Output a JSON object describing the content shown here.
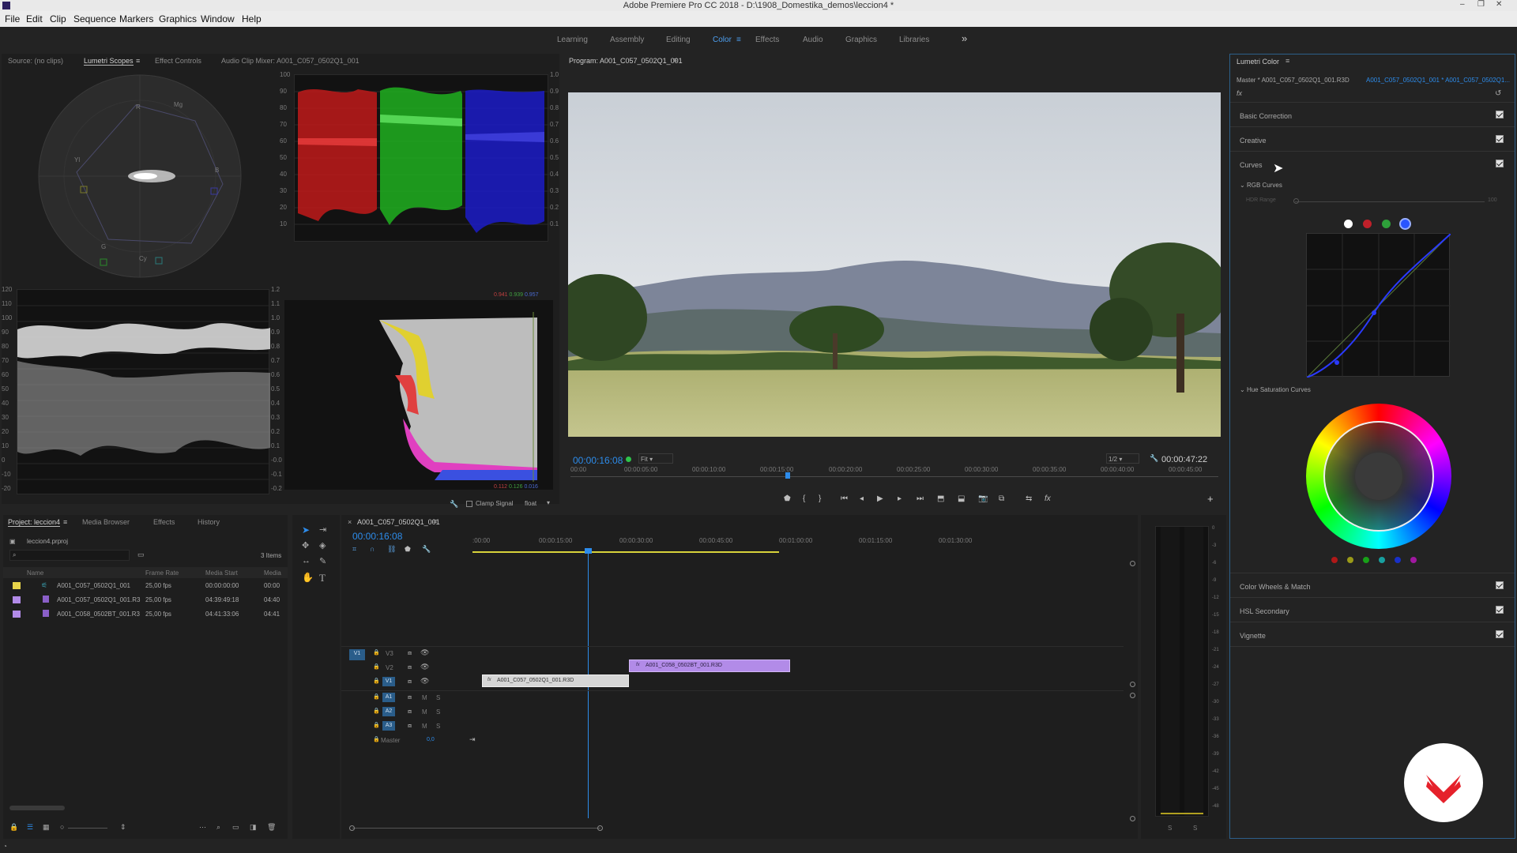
{
  "window": {
    "title": "Adobe Premiere Pro CC 2018 - D:\\1908_Domestika_demos\\leccion4 *"
  },
  "menu": [
    "File",
    "Edit",
    "Clip",
    "Sequence",
    "Markers",
    "Graphics",
    "Window",
    "Help"
  ],
  "workspaces": [
    "Learning",
    "Assembly",
    "Editing",
    "Color",
    "Effects",
    "Audio",
    "Graphics",
    "Libraries"
  ],
  "active_workspace": "Color",
  "source_panel": {
    "tabs": [
      "Source: (no clips)",
      "Lumetri Scopes",
      "Effect Controls",
      "Audio Clip Mixer: A001_C057_0502Q1_001"
    ],
    "parade_scale": [
      "100",
      "90",
      "80",
      "70",
      "60",
      "50",
      "40",
      "30",
      "20",
      "10"
    ],
    "parade_right_scale": [
      "1.0",
      "0.9",
      "0.8",
      "0.7",
      "0.6",
      "0.5",
      "0.4",
      "0.3",
      "0.2",
      "0.1"
    ],
    "waveform_scale": [
      "120",
      "110",
      "100",
      "90",
      "80",
      "70",
      "60",
      "50",
      "40",
      "30",
      "20",
      "10",
      "0",
      "-10",
      "-20"
    ],
    "waveform_right_scale": [
      "1.2",
      "1.1",
      "1.0",
      "0.9",
      "0.8",
      "0.7",
      "0.6",
      "0.5",
      "0.4",
      "0.3",
      "0.2",
      "0.1",
      "-0.0",
      "-0.1",
      "-0.2"
    ],
    "hist_top_values": [
      "0.941",
      "0.939",
      "0.957"
    ],
    "hist_bottom_values": [
      "0.112",
      "0.126",
      "0.016"
    ],
    "clamp_signal": "Clamp Signal",
    "float_label": "float",
    "vectorscope_labels": [
      "R",
      "Mg",
      "B",
      "Cy",
      "G",
      "Yl"
    ]
  },
  "program": {
    "tab": "Program: A001_C057_0502Q1_001",
    "timecode": "00:00:16:08",
    "fit": "Fit",
    "resolution": "1/2",
    "duration": "00:00:47:22",
    "ruler": [
      "00:00",
      "00:00:05:00",
      "00:00:10:00",
      "00:00:15:00",
      "00:00:20:00",
      "00:00:25:00",
      "00:00:30:00",
      "00:00:35:00",
      "00:00:40:00",
      "00:00:45:00"
    ]
  },
  "lumetri": {
    "title": "Lumetri Color",
    "master": "Master * A001_C057_0502Q1_001.R3D",
    "clip": "A001_C057_0502Q1_001 * A001_C057_0502Q1...",
    "fx": "fx",
    "sections": [
      "Basic Correction",
      "Creative",
      "Curves"
    ],
    "rgb_curves": "RGB Curves",
    "hdr_range": "HDR Range",
    "hdr_value": "100",
    "hue_sat": "Hue Saturation Curves",
    "bottom_sections": [
      "Color Wheels & Match",
      "HSL Secondary",
      "Vignette"
    ],
    "channel_colors": [
      "#ffffff",
      "#c0202a",
      "#2ea03a",
      "#2a55ff"
    ],
    "swatches": [
      "#b01818",
      "#9a9a18",
      "#18a018",
      "#18a0a0",
      "#1830c8",
      "#a018a0"
    ]
  },
  "project": {
    "tabs": [
      "Project: leccion4",
      "Media Browser",
      "Effects",
      "History"
    ],
    "file": "leccion4.prproj",
    "items_count": "3 Items",
    "columns": [
      "Name",
      "Frame Rate",
      "Media Start",
      "Media"
    ],
    "rows": [
      {
        "color": "#e7d44a",
        "name": "A001_C057_0502Q1_001",
        "fps": "25,00 fps",
        "start": "00:00:00:00",
        "media": "00:00"
      },
      {
        "color": "#b28be8",
        "name": "A001_C057_0502Q1_001.R3",
        "fps": "25,00 fps",
        "start": "04:39:49:18",
        "media": "04:40"
      },
      {
        "color": "#b28be8",
        "name": "A001_C058_0502BT_001.R3",
        "fps": "25,00 fps",
        "start": "04:41:33:06",
        "media": "04:41"
      }
    ]
  },
  "timeline": {
    "tab": "A001_C057_0502Q1_001",
    "timecode": "00:00:16:08",
    "ruler": [
      ":00:00",
      "00:00:15:00",
      "00:00:30:00",
      "00:00:45:00",
      "00:01:00:00",
      "00:01:15:00",
      "00:01:30:00"
    ],
    "video_tracks": [
      "V3",
      "V2",
      "V1"
    ],
    "audio_tracks": [
      "A1",
      "A2",
      "A3"
    ],
    "master": "Master",
    "master_value": "0,0",
    "clip_v1": "A001_C057_0502Q1_001.R3D",
    "clip_v2": "A001_C058_0502BT_001.R3D",
    "source_patch": "V1"
  },
  "audio_meter": {
    "scale": [
      "0",
      "-3",
      "-6",
      "-9",
      "-12",
      "-15",
      "-18",
      "-21",
      "-24",
      "-27",
      "-30",
      "-33",
      "-36",
      "-39",
      "-42",
      "-45",
      "-48"
    ],
    "solo": [
      "S",
      "S"
    ]
  }
}
